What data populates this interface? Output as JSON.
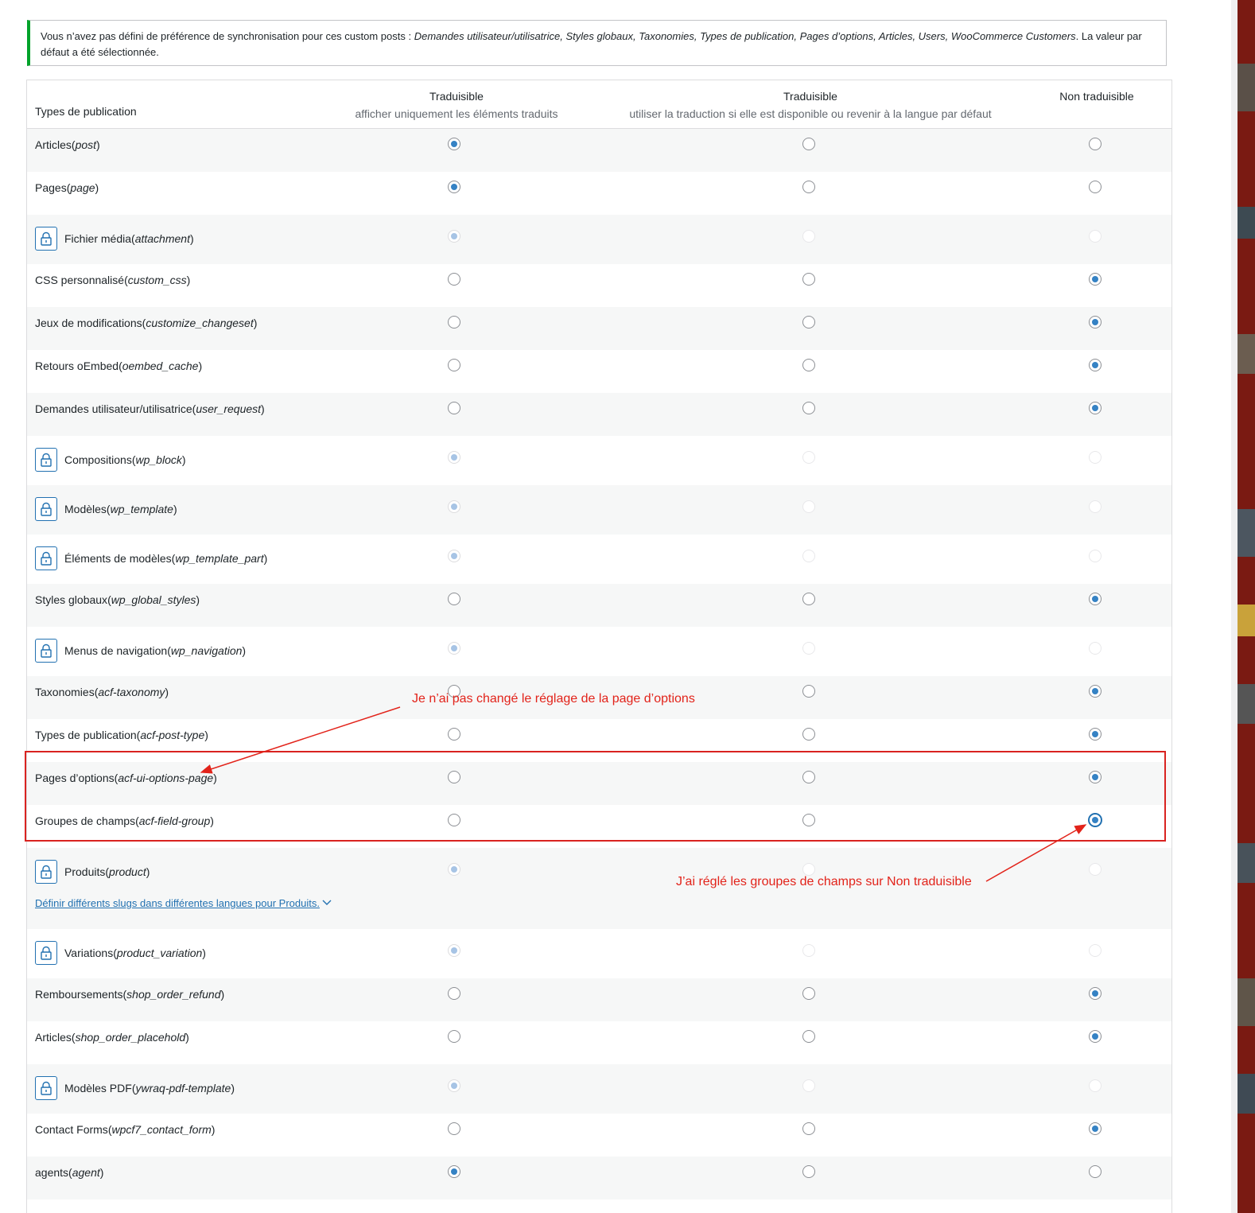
{
  "notice": {
    "prefix": "Vous n’avez pas défini de préférence de synchronisation pour ces custom posts : ",
    "items": "Demandes utilisateur/utilisatrice, Styles globaux, Taxonomies, Types de publication, Pages d’options, Articles, Users, WooCommerce Customers",
    "suffix": ". La valeur par défaut a été sélectionnée.",
    "accent_color": "#00a32a"
  },
  "table": {
    "header": {
      "types_label": "Types de publication",
      "col1_title": "Traduisible",
      "col1_sub": "afficher uniquement les éléments traduits",
      "col2_title": "Traduisible",
      "col2_sub": "utiliser la traduction si elle est disponible ou revenir à la langue par défaut",
      "col3_title": "Non traduisible"
    },
    "rows": [
      {
        "name": "Articles",
        "slug": "post",
        "locked": false,
        "selected": 1
      },
      {
        "name": "Pages",
        "slug": "page",
        "locked": false,
        "selected": 1
      },
      {
        "name": "Fichier média",
        "slug": "attachment",
        "locked": true,
        "selected": 1
      },
      {
        "name": "CSS personnalisé",
        "slug": "custom_css",
        "locked": false,
        "selected": 3
      },
      {
        "name": "Jeux de modifications",
        "slug": "customize_changeset",
        "locked": false,
        "selected": 3
      },
      {
        "name": "Retours oEmbed",
        "slug": "oembed_cache",
        "locked": false,
        "selected": 3
      },
      {
        "name": "Demandes utilisateur/utilisatrice",
        "slug": "user_request",
        "locked": false,
        "selected": 3
      },
      {
        "name": "Compositions",
        "slug": "wp_block",
        "locked": true,
        "selected": 1
      },
      {
        "name": "Modèles",
        "slug": "wp_template",
        "locked": true,
        "selected": 1
      },
      {
        "name": "Éléments de modèles",
        "slug": "wp_template_part",
        "locked": true,
        "selected": 1
      },
      {
        "name": "Styles globaux",
        "slug": "wp_global_styles",
        "locked": false,
        "selected": 3
      },
      {
        "name": "Menus de navigation",
        "slug": "wp_navigation",
        "locked": true,
        "selected": 1
      },
      {
        "name": "Taxonomies",
        "slug": "acf-taxonomy",
        "locked": false,
        "selected": 3
      },
      {
        "name": "Types de publication",
        "slug": "acf-post-type",
        "locked": false,
        "selected": 3
      },
      {
        "name": "Pages d’options",
        "slug": "acf-ui-options-page",
        "locked": false,
        "selected": 3
      },
      {
        "name": "Groupes de champs",
        "slug": "acf-field-group",
        "locked": false,
        "selected": 3
      },
      {
        "name": "Produits",
        "slug": "product",
        "locked": true,
        "selected": 1
      },
      {
        "name": "Variations",
        "slug": "product_variation",
        "locked": true,
        "selected": 1
      },
      {
        "name": "Remboursements",
        "slug": "shop_order_refund",
        "locked": false,
        "selected": 3
      },
      {
        "name": "Articles",
        "slug": "shop_order_placehold",
        "locked": false,
        "selected": 3
      },
      {
        "name": "Modèles PDF",
        "slug": "ywraq-pdf-template",
        "locked": true,
        "selected": 1
      },
      {
        "name": "Contact Forms",
        "slug": "wpcf7_contact_form",
        "locked": false,
        "selected": 3
      },
      {
        "name": "agents",
        "slug": "agent",
        "locked": false,
        "selected": 1
      }
    ],
    "slug_link_products": "Définir différents slugs dans différentes langues pour Produits."
  },
  "annotations": {
    "note_options_page": "Je n’ai pas changé le réglage de la page d’options",
    "note_field_groups": "J’ai réglé les groupes de champs sur Non traduisible",
    "color": "#e2231a"
  }
}
